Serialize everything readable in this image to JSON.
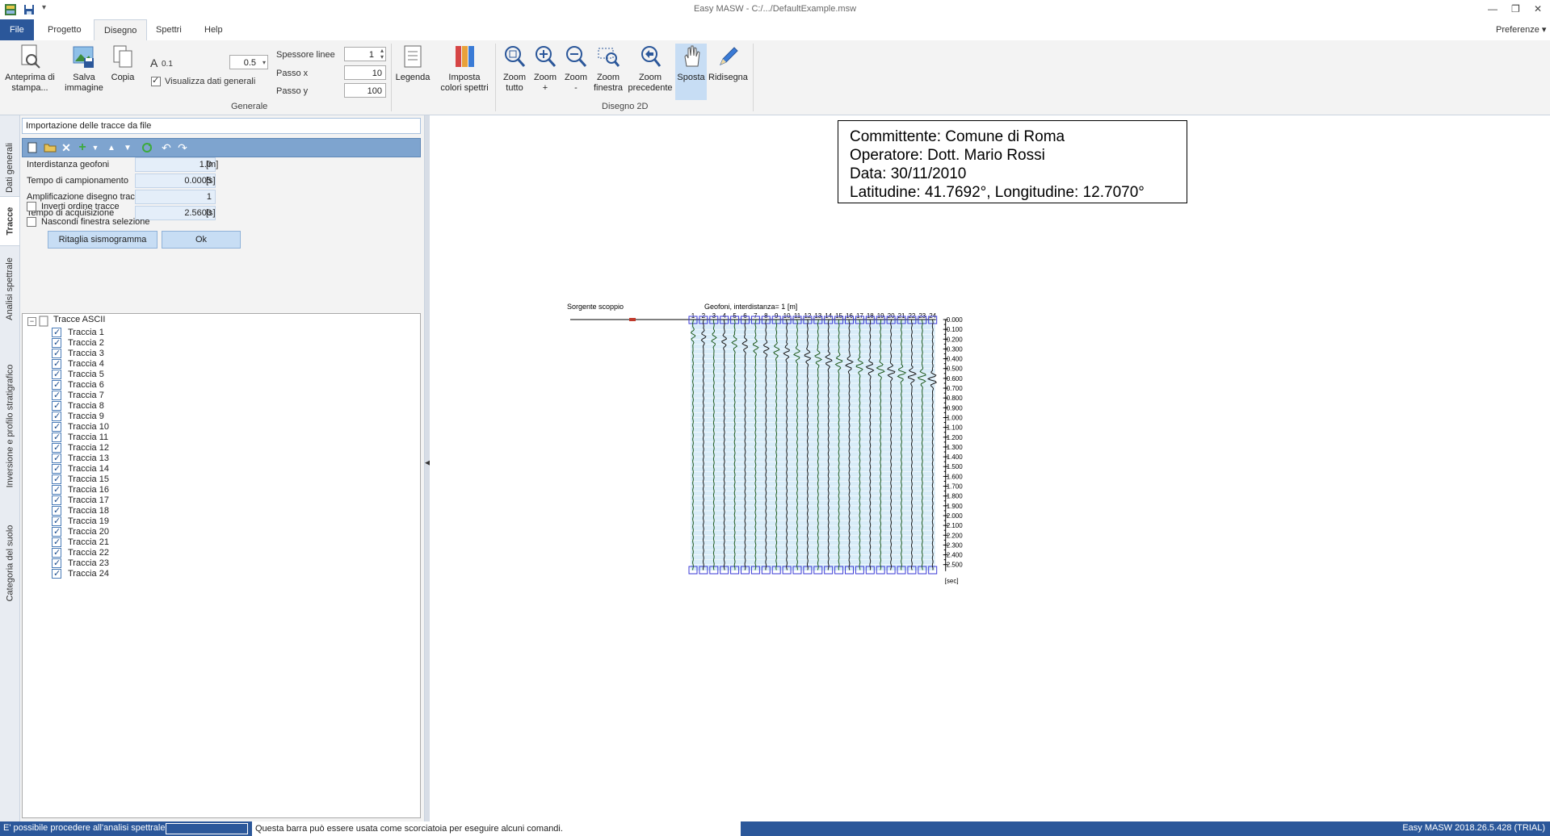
{
  "window": {
    "title": "Easy MASW - C:/.../DefaultExample.msw"
  },
  "tabs": {
    "file": "File",
    "progetto": "Progetto",
    "disegno": "Disegno",
    "spettri": "Spettri",
    "help": "Help",
    "preferenze": "Preferenze"
  },
  "ribbon": {
    "anteprima": "Anteprima di stampa...",
    "salva": "Salva immagine",
    "copia": "Copia",
    "font_size_small": "0.1",
    "font_size_value": "0.5",
    "visualizza_label": "Visualizza dati generali",
    "visualizza_checked": true,
    "spessore_label": "Spessore linee",
    "spessore_value": "1",
    "passo_x_label": "Passo x",
    "passo_x_value": "10",
    "passo_y_label": "Passo y",
    "passo_y_value": "100",
    "legenda": "Legenda",
    "imposta": "Imposta colori spettri",
    "group_generale": "Generale",
    "zoom_tutto": "Zoom tutto",
    "zoom_plus": "Zoom +",
    "zoom_minus": "Zoom -",
    "zoom_finestra": "Zoom finestra",
    "zoom_precedente": "Zoom precedente",
    "sposta": "Sposta",
    "ridisegna": "Ridisegna",
    "group_disegno2d": "Disegno 2D"
  },
  "sidetabs": [
    "Dati generali",
    "Tracce",
    "Analisi spettrale",
    "Inversione e profilo stratigrafico",
    "Categoria del suolo"
  ],
  "panel": {
    "header": "Importazione delle tracce da file",
    "fields": [
      {
        "label": "Interdistanza geofoni",
        "value": "1.0",
        "unit": "[m]"
      },
      {
        "label": "Tempo di campionamento",
        "value": "0.0005",
        "unit": "[s]"
      },
      {
        "label": "Amplificazione disegno tracce",
        "value": "1",
        "unit": ""
      },
      {
        "label": "Tempo di acquisizione",
        "value": "2.5600",
        "unit": "[s]"
      }
    ],
    "inverti": "Inverti ordine tracce",
    "nascondi": "Nascondi finestra selezione",
    "ritaglia": "Ritaglia sismogramma",
    "ok": "Ok",
    "tree_root": "Tracce ASCII",
    "traces": [
      "Traccia 1",
      "Traccia 2",
      "Traccia 3",
      "Traccia 4",
      "Traccia 5",
      "Traccia 6",
      "Traccia 7",
      "Traccia 8",
      "Traccia 9",
      "Traccia 10",
      "Traccia 11",
      "Traccia 12",
      "Traccia 13",
      "Traccia 14",
      "Traccia 15",
      "Traccia 16",
      "Traccia 17",
      "Traccia 18",
      "Traccia 19",
      "Traccia 20",
      "Traccia 21",
      "Traccia 22",
      "Traccia 23",
      "Traccia 24"
    ]
  },
  "drawing": {
    "info": {
      "committente": "Committente: Comune di Roma",
      "operatore": "Operatore: Dott. Mario Rossi",
      "data": "Data: 30/11/2010",
      "coords": "Latitudine: 41.7692°, Longitudine: 12.7070°"
    },
    "source_label": "Sorgente scoppio",
    "geophones_label": "Geofoni, interdistanza= 1 [m]",
    "geophone_numbers": [
      "1",
      "2",
      "3",
      "4",
      "5",
      "6",
      "7",
      "8",
      "9",
      "10",
      "11",
      "12",
      "13",
      "14",
      "15",
      "16",
      "17",
      "18",
      "19",
      "20",
      "21",
      "22",
      "23",
      "24"
    ],
    "time_ticks": [
      "0.000",
      "0.100",
      "0.200",
      "0.300",
      "0.400",
      "0.500",
      "0.600",
      "0.700",
      "0.800",
      "0.900",
      "1.000",
      "1.100",
      "1.200",
      "1.300",
      "1.400",
      "1.500",
      "1.600",
      "1.700",
      "1.800",
      "1.900",
      "2.000",
      "2.100",
      "2.200",
      "2.300",
      "2.400",
      "2.500"
    ],
    "time_unit": "[sec]",
    "first_arrival_sec": 0.08,
    "arrival_step_sec": 0.0195,
    "colors": {
      "trace_fill": "#d8ecf8",
      "geophone": "#3a3ad6",
      "source": "#c0392b"
    }
  },
  "status": {
    "left": "E' possibile procedere all'analisi spettrale.",
    "hint": "Questa barra può essere usata come scorciatoia per eseguire alcuni comandi.",
    "right": "Easy MASW 2018.26.5.428 (TRIAL)"
  }
}
